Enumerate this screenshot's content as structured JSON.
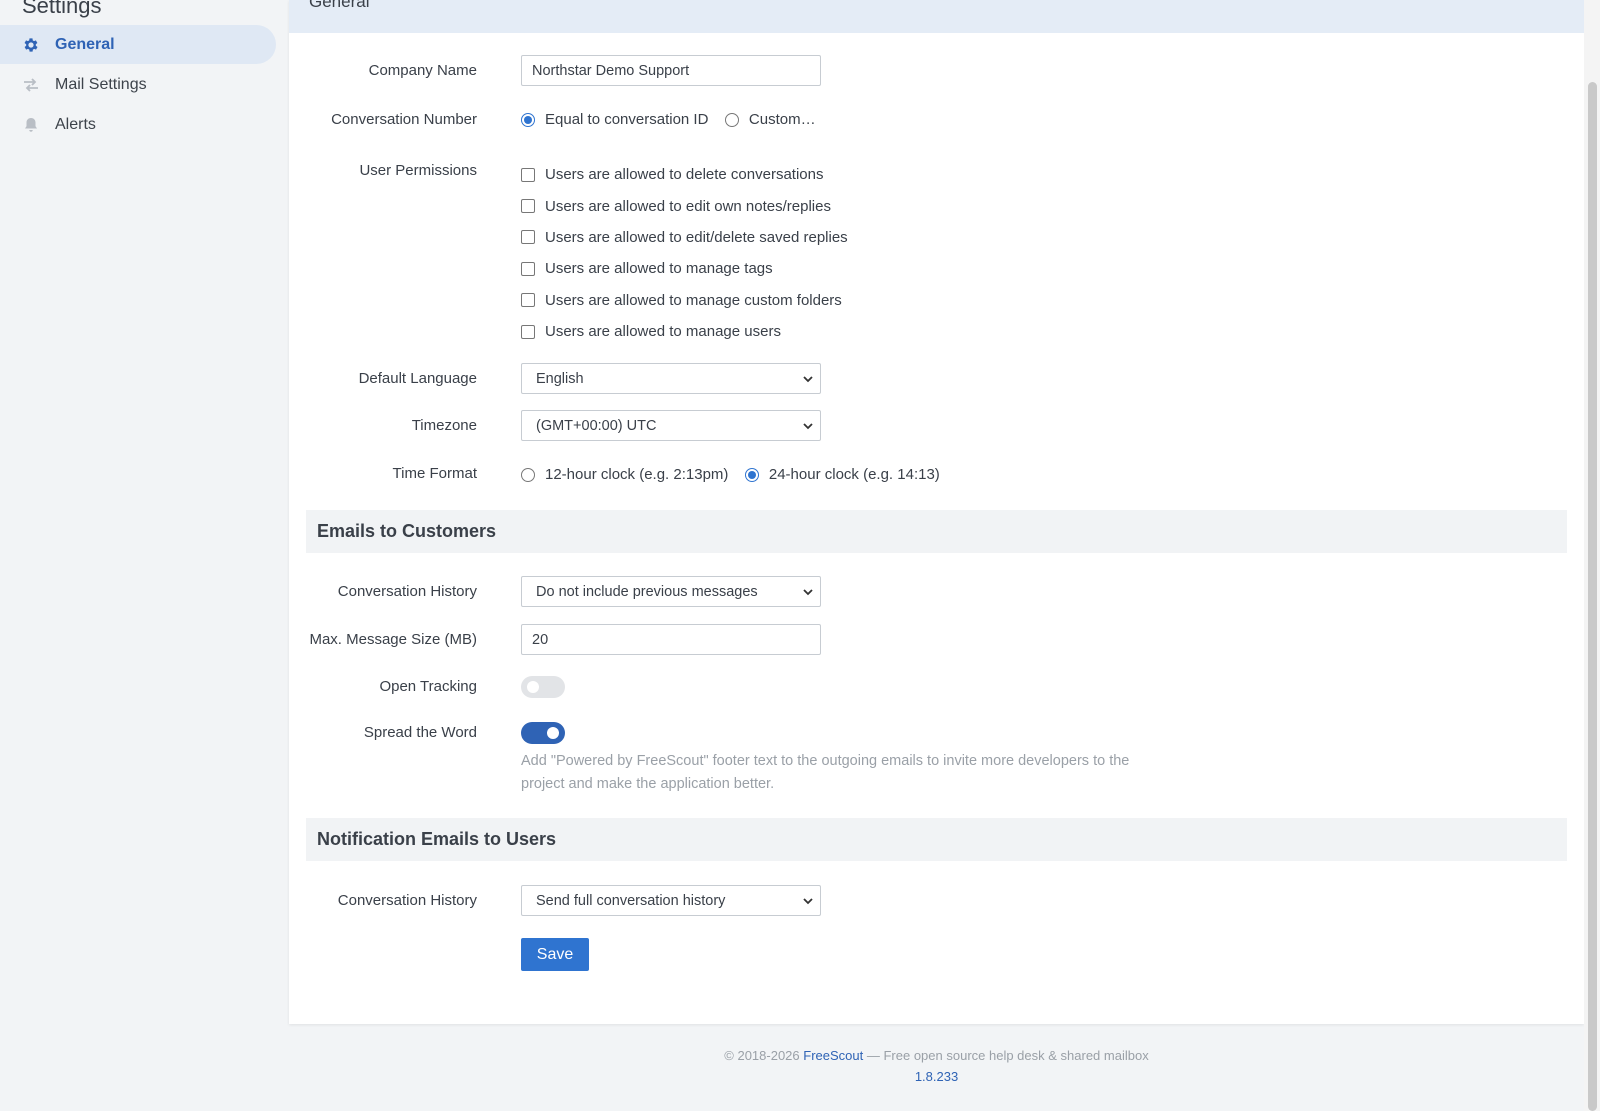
{
  "sidebar": {
    "title": "Settings",
    "items": [
      {
        "label": "General",
        "icon": "gear-icon"
      },
      {
        "label": "Mail Settings",
        "icon": "exchange-arrows-icon"
      },
      {
        "label": "Alerts",
        "icon": "bell-icon"
      }
    ]
  },
  "panel": {
    "title": "General",
    "company_name": {
      "label": "Company Name",
      "value": "Northstar Demo Support"
    },
    "conversation_number": {
      "label": "Conversation Number",
      "options": [
        "Equal to conversation ID",
        "Custom…"
      ],
      "selected": "Equal to conversation ID"
    },
    "user_permissions": {
      "label": "User Permissions",
      "options": [
        "Users are allowed to delete conversations",
        "Users are allowed to edit own notes/replies",
        "Users are allowed to edit/delete saved replies",
        "Users are allowed to manage tags",
        "Users are allowed to manage custom folders",
        "Users are allowed to manage users"
      ],
      "checked": [
        false,
        false,
        false,
        false,
        false,
        false
      ]
    },
    "default_language": {
      "label": "Default Language",
      "value": "English"
    },
    "timezone": {
      "label": "Timezone",
      "value": "(GMT+00:00) UTC"
    },
    "time_format": {
      "label": "Time Format",
      "options": [
        "12-hour clock (e.g. 2:13pm)",
        "24-hour clock (e.g. 14:13)"
      ],
      "selected": "24-hour clock (e.g. 14:13)"
    },
    "emails_to_customers": {
      "heading": "Emails to Customers",
      "conversation_history": {
        "label": "Conversation History",
        "value": "Do not include previous messages"
      },
      "max_message_size": {
        "label": "Max. Message Size (MB)",
        "value": "20"
      },
      "open_tracking": {
        "label": "Open Tracking",
        "enabled": false
      },
      "spread_the_word": {
        "label": "Spread the Word",
        "enabled": true,
        "help": "Add \"Powered by FreeScout\" footer text to the outgoing emails to invite more developers to the project and make the application better."
      }
    },
    "notification_emails": {
      "heading": "Notification Emails to Users",
      "conversation_history": {
        "label": "Conversation History",
        "value": "Send full conversation history"
      }
    },
    "save_label": "Save"
  },
  "footer": {
    "copyright": "© 2018-2026",
    "brand": "FreeScout",
    "tagline": "— Free open source help desk & shared mailbox",
    "version": "1.8.233"
  },
  "colors": {
    "accent": "#2f74d0",
    "active_nav_bg": "#dfe8f4",
    "toggle_on": "#2f63b5"
  }
}
